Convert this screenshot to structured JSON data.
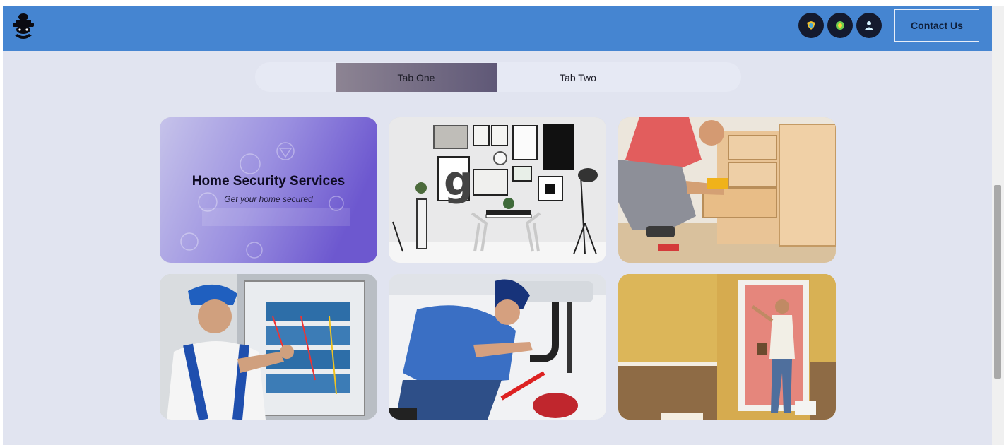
{
  "header": {
    "logo_icon": "ninja-logo-icon",
    "icons": [
      "badge-icon",
      "circle-dot-icon",
      "user-icon"
    ],
    "contact_label": "Contact Us",
    "background": "#4585d1"
  },
  "tabs": [
    {
      "label": "Tab One",
      "active": true
    },
    {
      "label": "Tab Two",
      "active": false
    }
  ],
  "hero_card": {
    "title": "Home Security Services",
    "subtitle": "Get your home secured"
  },
  "cards": [
    {
      "image": "interior-gallery-wall-photo"
    },
    {
      "image": "carpenter-drilling-drawers-photo"
    },
    {
      "image": "electrician-panel-photo"
    },
    {
      "image": "plumber-sink-photo"
    },
    {
      "image": "painter-wall-photo"
    }
  ]
}
